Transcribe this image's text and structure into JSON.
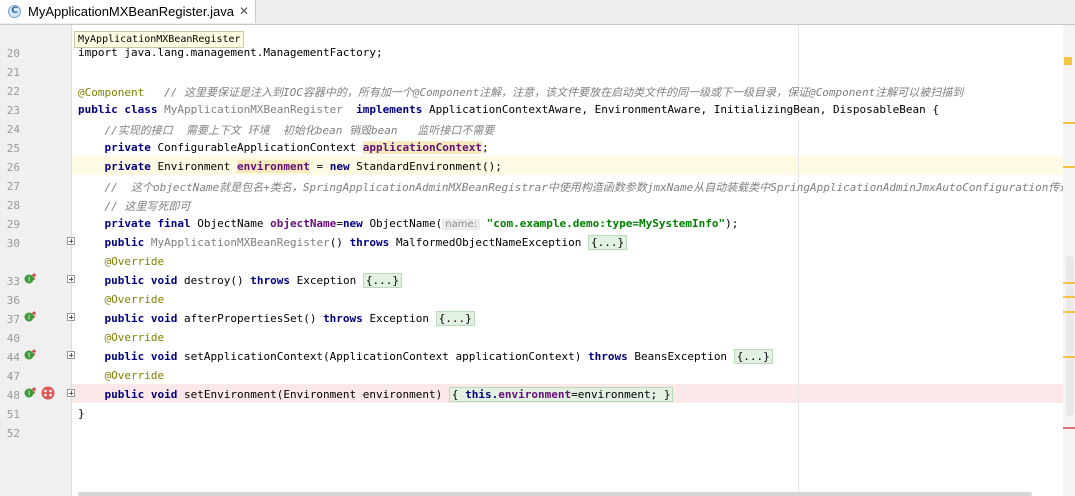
{
  "tab": {
    "title": "MyApplicationMXBeanRegister.java",
    "icon_letter": "C",
    "close": "✕"
  },
  "tooltip": {
    "text": "MyApplicationMXBeanRegister"
  },
  "line_numbers": [
    "20",
    "21",
    "22",
    "23",
    "24",
    "25",
    "26",
    "27",
    "28",
    "29",
    "30",
    "33",
    "36",
    "37",
    "40",
    "44",
    "47",
    "48",
    "51",
    "52"
  ],
  "code": {
    "l20": "import java.lang.management.ManagementFactory;",
    "l22_ann": "@Component",
    "l22_cmt": "// 这里要保证是注入到IOC容器中的，所有加一个@Component注解，注意，该文件要放在启动类文件的同一级或下一级目录，保证@Component注解可以被扫描到",
    "l23_a": "public class",
    "l23_b": "MyApplicationMXBeanRegister",
    "l23_c": "implements",
    "l23_d": "ApplicationContextAware, EnvironmentAware, InitializingBean, DisposableBean {",
    "l24": "//实现的接口  需要上下文 环境  初始化bean 销毁bean   监听接口不需要",
    "l25_a": "private",
    "l25_b": "ConfigurableApplicationContext",
    "l25_c": "applicationContext",
    "l25_d": ";",
    "l26_a": "private",
    "l26_b": "Environment",
    "l26_c": "environment",
    "l26_d": "=",
    "l26_e": "new",
    "l26_f": "StandardEnvironment();",
    "l27": "//  这个objectName就是包名+类名，SpringApplicationAdminMXBeanRegistrar中使用构造函数参数jmxName从自动装载类中SpringApplicationAdminJmxAutoConfiguration传递过来，",
    "l28": "// 这里写死即可",
    "l29_a": "private final",
    "l29_b": "ObjectName",
    "l29_c": "objectName",
    "l29_d": "=",
    "l29_e": "new",
    "l29_f": "ObjectName(",
    "l29_hint": "name:",
    "l29_str": "\"com.example.demo:type=MySystemInfo\"",
    "l29_g": ");",
    "l30_a": "public",
    "l30_b": "MyApplicationMXBeanRegister",
    "l30_c": "()",
    "l30_d": "throws",
    "l30_e": "MalformedObjectNameException",
    "fold": "{...}",
    "override": "@Override",
    "l33_a": "public void",
    "l33_b": "destroy()",
    "l33_c": "throws",
    "l33_d": "Exception",
    "l37_a": "public void",
    "l37_b": "afterPropertiesSet()",
    "l37_c": "throws",
    "l37_d": "Exception",
    "l44_a": "public void",
    "l44_b": "setApplicationContext(ApplicationContext applicationContext)",
    "l44_c": "throws",
    "l44_d": "BeansException",
    "l48_a": "public void",
    "l48_b": "setEnvironment(Environment environment)",
    "l48_c": "{",
    "l48_d": "this.",
    "l48_e": "environment",
    "l48_f": "=environment;",
    "l48_g": "}",
    "l51": "}"
  },
  "colors": {
    "keyword": "#000080",
    "annotation": "#808000",
    "comment": "#808080",
    "field": "#660e7a",
    "string": "#008000",
    "gutter_bg": "#f0f0f0",
    "caret_line": "#fffae3",
    "error_line": "#fbe8e8",
    "stripe_warning": "#f5c342"
  }
}
